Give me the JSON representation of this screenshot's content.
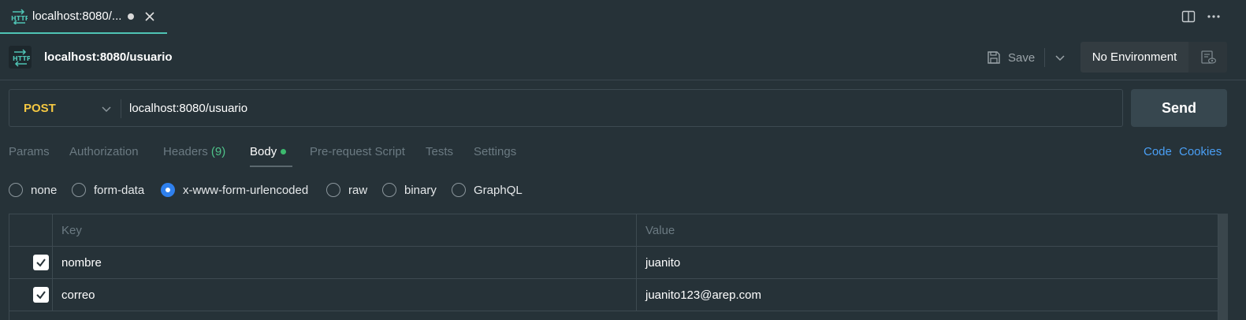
{
  "tab": {
    "title": "localhost:8080/...",
    "icon": "http-icon"
  },
  "header": {
    "title": "localhost:8080/usuario",
    "save_label": "Save",
    "environment": "No Environment"
  },
  "request": {
    "method": "POST",
    "url": "localhost:8080/usuario",
    "send_label": "Send"
  },
  "request_tabs": {
    "params": "Params",
    "authorization": "Authorization",
    "headers": "Headers",
    "headers_count": "(9)",
    "body": "Body",
    "pre_request": "Pre-request Script",
    "tests": "Tests",
    "settings": "Settings",
    "code": "Code",
    "cookies": "Cookies"
  },
  "body_types": {
    "none": "none",
    "form_data": "form-data",
    "urlencoded": "x-www-form-urlencoded",
    "raw": "raw",
    "binary": "binary",
    "graphql": "GraphQL",
    "selected": "x-www-form-urlencoded"
  },
  "table": {
    "headers": {
      "key": "Key",
      "value": "Value"
    },
    "rows": [
      {
        "key": "nombre",
        "value": "juanito",
        "enabled": true
      },
      {
        "key": "correo",
        "value": "juanito123@arep.com",
        "enabled": true
      }
    ]
  },
  "colors": {
    "background": "#263238",
    "method": "#f5c842",
    "accent_tab": "#4fc3b4",
    "link": "#4a9ff5",
    "radio_selected": "#2f80ed"
  }
}
